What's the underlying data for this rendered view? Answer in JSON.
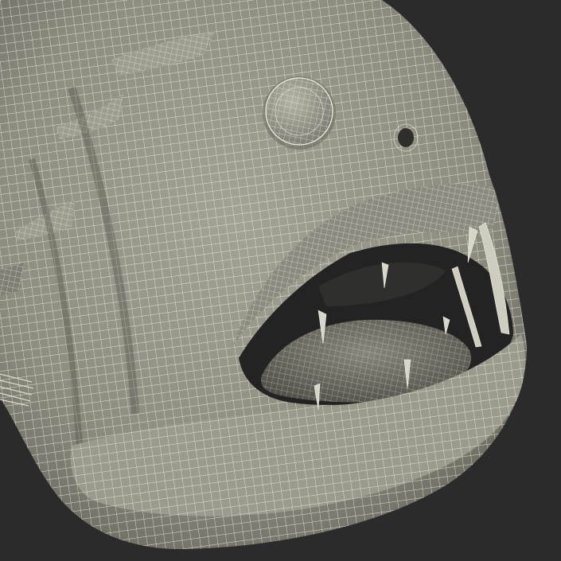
{
  "scene": {
    "colors": {
      "background": "#2b2b2b",
      "surface": "#8e8d80",
      "surface_light": "#a3a294",
      "surface_dark": "#5f5e55",
      "wire": "#f2f0e4",
      "mouth_interior": "#232323",
      "tongue": "#6e6d64"
    },
    "elements": [
      "wireframe-fish-head",
      "eye",
      "nostril",
      "open-mouth",
      "tongue",
      "fang-teeth",
      "dorsal-spines"
    ]
  }
}
